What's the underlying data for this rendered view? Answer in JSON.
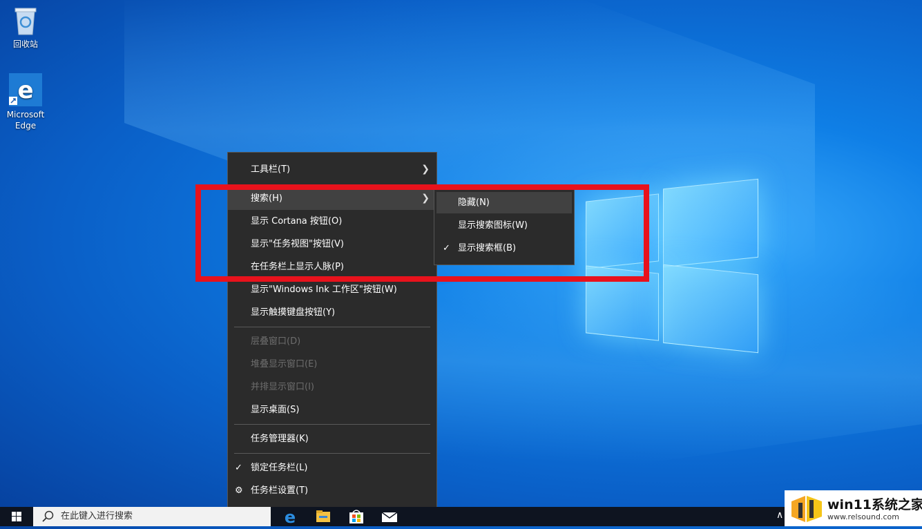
{
  "desktop": {
    "icons": [
      {
        "label": "回收站"
      },
      {
        "label": "Microsoft Edge"
      }
    ]
  },
  "context_menu": {
    "items": [
      {
        "label": "工具栏(T)",
        "submenu": true
      },
      {
        "label": "搜索(H)",
        "submenu": true,
        "highlighted": true
      },
      {
        "label": "显示 Cortana 按钮(O)"
      },
      {
        "label": "显示\"任务视图\"按钮(V)"
      },
      {
        "label": "在任务栏上显示人脉(P)"
      },
      {
        "label": "显示\"Windows Ink 工作区\"按钮(W)"
      },
      {
        "label": "显示触摸键盘按钮(Y)"
      },
      {
        "label": "层叠窗口(D)",
        "disabled": true
      },
      {
        "label": "堆叠显示窗口(E)",
        "disabled": true
      },
      {
        "label": "并排显示窗口(I)",
        "disabled": true
      },
      {
        "label": "显示桌面(S)"
      },
      {
        "label": "任务管理器(K)"
      },
      {
        "label": "锁定任务栏(L)",
        "checked": true
      },
      {
        "label": "任务栏设置(T)",
        "icon": "gear-icon"
      }
    ]
  },
  "search_submenu": {
    "items": [
      {
        "label": "隐藏(N)",
        "highlighted": true
      },
      {
        "label": "显示搜索图标(W)"
      },
      {
        "label": "显示搜索框(B)",
        "checked": true
      }
    ]
  },
  "taskbar": {
    "search_placeholder": "在此键入进行搜索",
    "pinned": [
      "edge-icon",
      "file-explorer-icon",
      "store-icon",
      "mail-icon"
    ]
  },
  "watermark": {
    "title": "win11系统之家",
    "url": "www.relsound.com"
  },
  "colors": {
    "menu_bg": "#2b2b2b",
    "highlight": "#414141",
    "annotation_red": "#e8121c",
    "taskbar": "#0e1420"
  }
}
